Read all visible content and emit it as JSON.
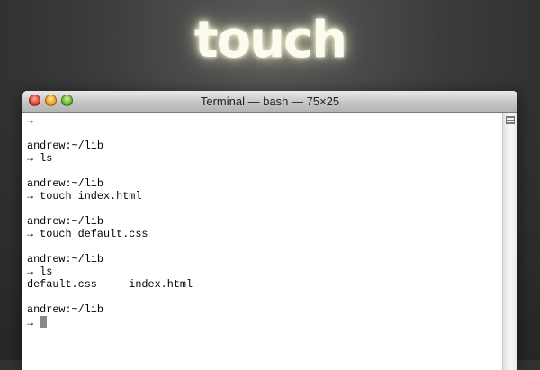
{
  "hero": {
    "title": "touch"
  },
  "window": {
    "title": "Terminal — bash — 75×25"
  },
  "terminal": {
    "lines": [
      "→",
      "",
      "andrew:~/lib",
      "→ ls",
      "",
      "andrew:~/lib",
      "→ touch index.html",
      "",
      "andrew:~/lib",
      "→ touch default.css",
      "",
      "andrew:~/lib",
      "→ ls",
      "default.css     index.html",
      "",
      "andrew:~/lib",
      "→ "
    ]
  },
  "icons": {
    "close": "close-button-icon",
    "minimize": "minimize-button-icon",
    "zoom": "zoom-button-icon",
    "scroll": "scroll-grip-icon"
  }
}
